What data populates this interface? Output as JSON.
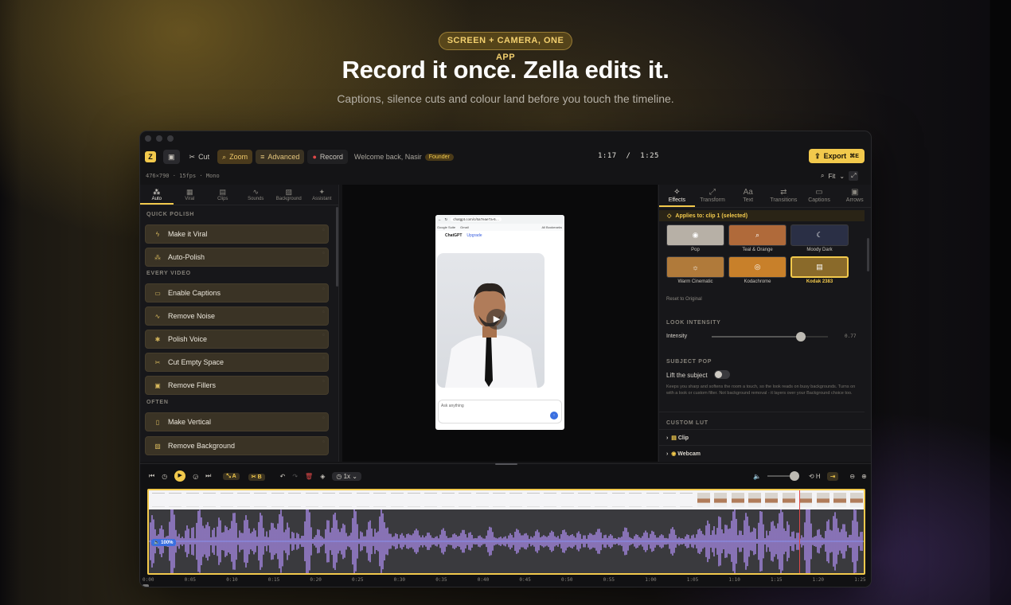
{
  "hero": {
    "badge": "SCREEN + CAMERA, ONE APP",
    "title": "Record it once. Zella edits it.",
    "subtitle": "Captions, silence cuts and colour land before you touch the timeline."
  },
  "toolbar": {
    "logo": "Z",
    "cut": "Cut",
    "zoom": "Zoom",
    "advanced": "Advanced",
    "record": "Record",
    "welcome": "Welcome back, Nasir",
    "badge": "Founder",
    "time_current": "1:17",
    "time_sep": "/",
    "time_total": "1:25",
    "export": "Export"
  },
  "meta": "476×790 · 15fps · Mono",
  "fit": "Fit",
  "left_tabs": [
    {
      "label": "Auto",
      "icon": "wand-icon"
    },
    {
      "label": "Viral",
      "icon": "grid-icon"
    },
    {
      "label": "Clips",
      "icon": "clips-icon"
    },
    {
      "label": "Sounds",
      "icon": "wave-icon"
    },
    {
      "label": "Background",
      "icon": "image-icon"
    },
    {
      "label": "Assistant",
      "icon": "sparkle-icon"
    }
  ],
  "sections": {
    "quick": "QUICK POLISH",
    "every": "EVERY VIDEO",
    "often": "OFTEN"
  },
  "actions": {
    "viral": "Make it Viral",
    "polish": "Auto-Polish",
    "captions": "Enable Captions",
    "noise": "Remove Noise",
    "voice": "Polish Voice",
    "empty": "Cut Empty Space",
    "fillers": "Remove Fillers",
    "vertical": "Make Vertical",
    "background": "Remove Background"
  },
  "phone": {
    "url": "chatgpt.com/c/6a7eae7a-6…",
    "bookmark1": "Google Suite",
    "bookmark2": "Gmail",
    "bookmarks": "All Bookmarks",
    "app": "ChatGPT",
    "upgrade": "Upgrade",
    "prompt": "Ask anything"
  },
  "right_tabs": [
    {
      "label": "Effects",
      "icon": "effects-icon"
    },
    {
      "label": "Transform",
      "icon": "transform-icon"
    },
    {
      "label": "Text",
      "icon": "text-icon"
    },
    {
      "label": "Transitions",
      "icon": "transitions-icon"
    },
    {
      "label": "Captions",
      "icon": "captions-icon"
    },
    {
      "label": "Arrows",
      "icon": "arrows-icon"
    }
  ],
  "applies": "Applies to: clip 1 (selected)",
  "looks": [
    {
      "label": "Pop",
      "color": "#b7b0a6"
    },
    {
      "label": "Teal & Orange",
      "color": "#b06a3a"
    },
    {
      "label": "Moody Dark",
      "color": "#2a2f45"
    },
    {
      "label": "Warm Cinematic",
      "color": "#b07a3a"
    },
    {
      "label": "Kodachrome",
      "color": "#c8802a"
    },
    {
      "label": "Kodak 2383",
      "color": "#8a6a2a"
    }
  ],
  "reset": "Reset to Original",
  "intensity": {
    "section": "LOOK INTENSITY",
    "label": "Intensity",
    "value": "0.77",
    "level": 0.77
  },
  "subject": {
    "section": "SUBJECT POP",
    "label": "Lift the subject",
    "desc": "Keeps you sharp and softens the room a touch, so the look reads on busy backgrounds. Turns on with a look or custom filter. Not background removal - it layers over your Background choice too."
  },
  "lut": {
    "section": "CUSTOM LUT",
    "clip": "Clip",
    "webcam": "Webcam"
  },
  "timeline": {
    "ab_a": "A",
    "ab_b": "B",
    "speed": "1x",
    "volume_h": "H",
    "gain": "100%",
    "playhead": 0.91,
    "ticks": [
      "0:00",
      "0:05",
      "0:10",
      "0:15",
      "0:20",
      "0:25",
      "0:30",
      "0:35",
      "0:40",
      "0:45",
      "0:50",
      "0:55",
      "1:00",
      "1:05",
      "1:10",
      "1:15",
      "1:20",
      "1:25"
    ]
  }
}
